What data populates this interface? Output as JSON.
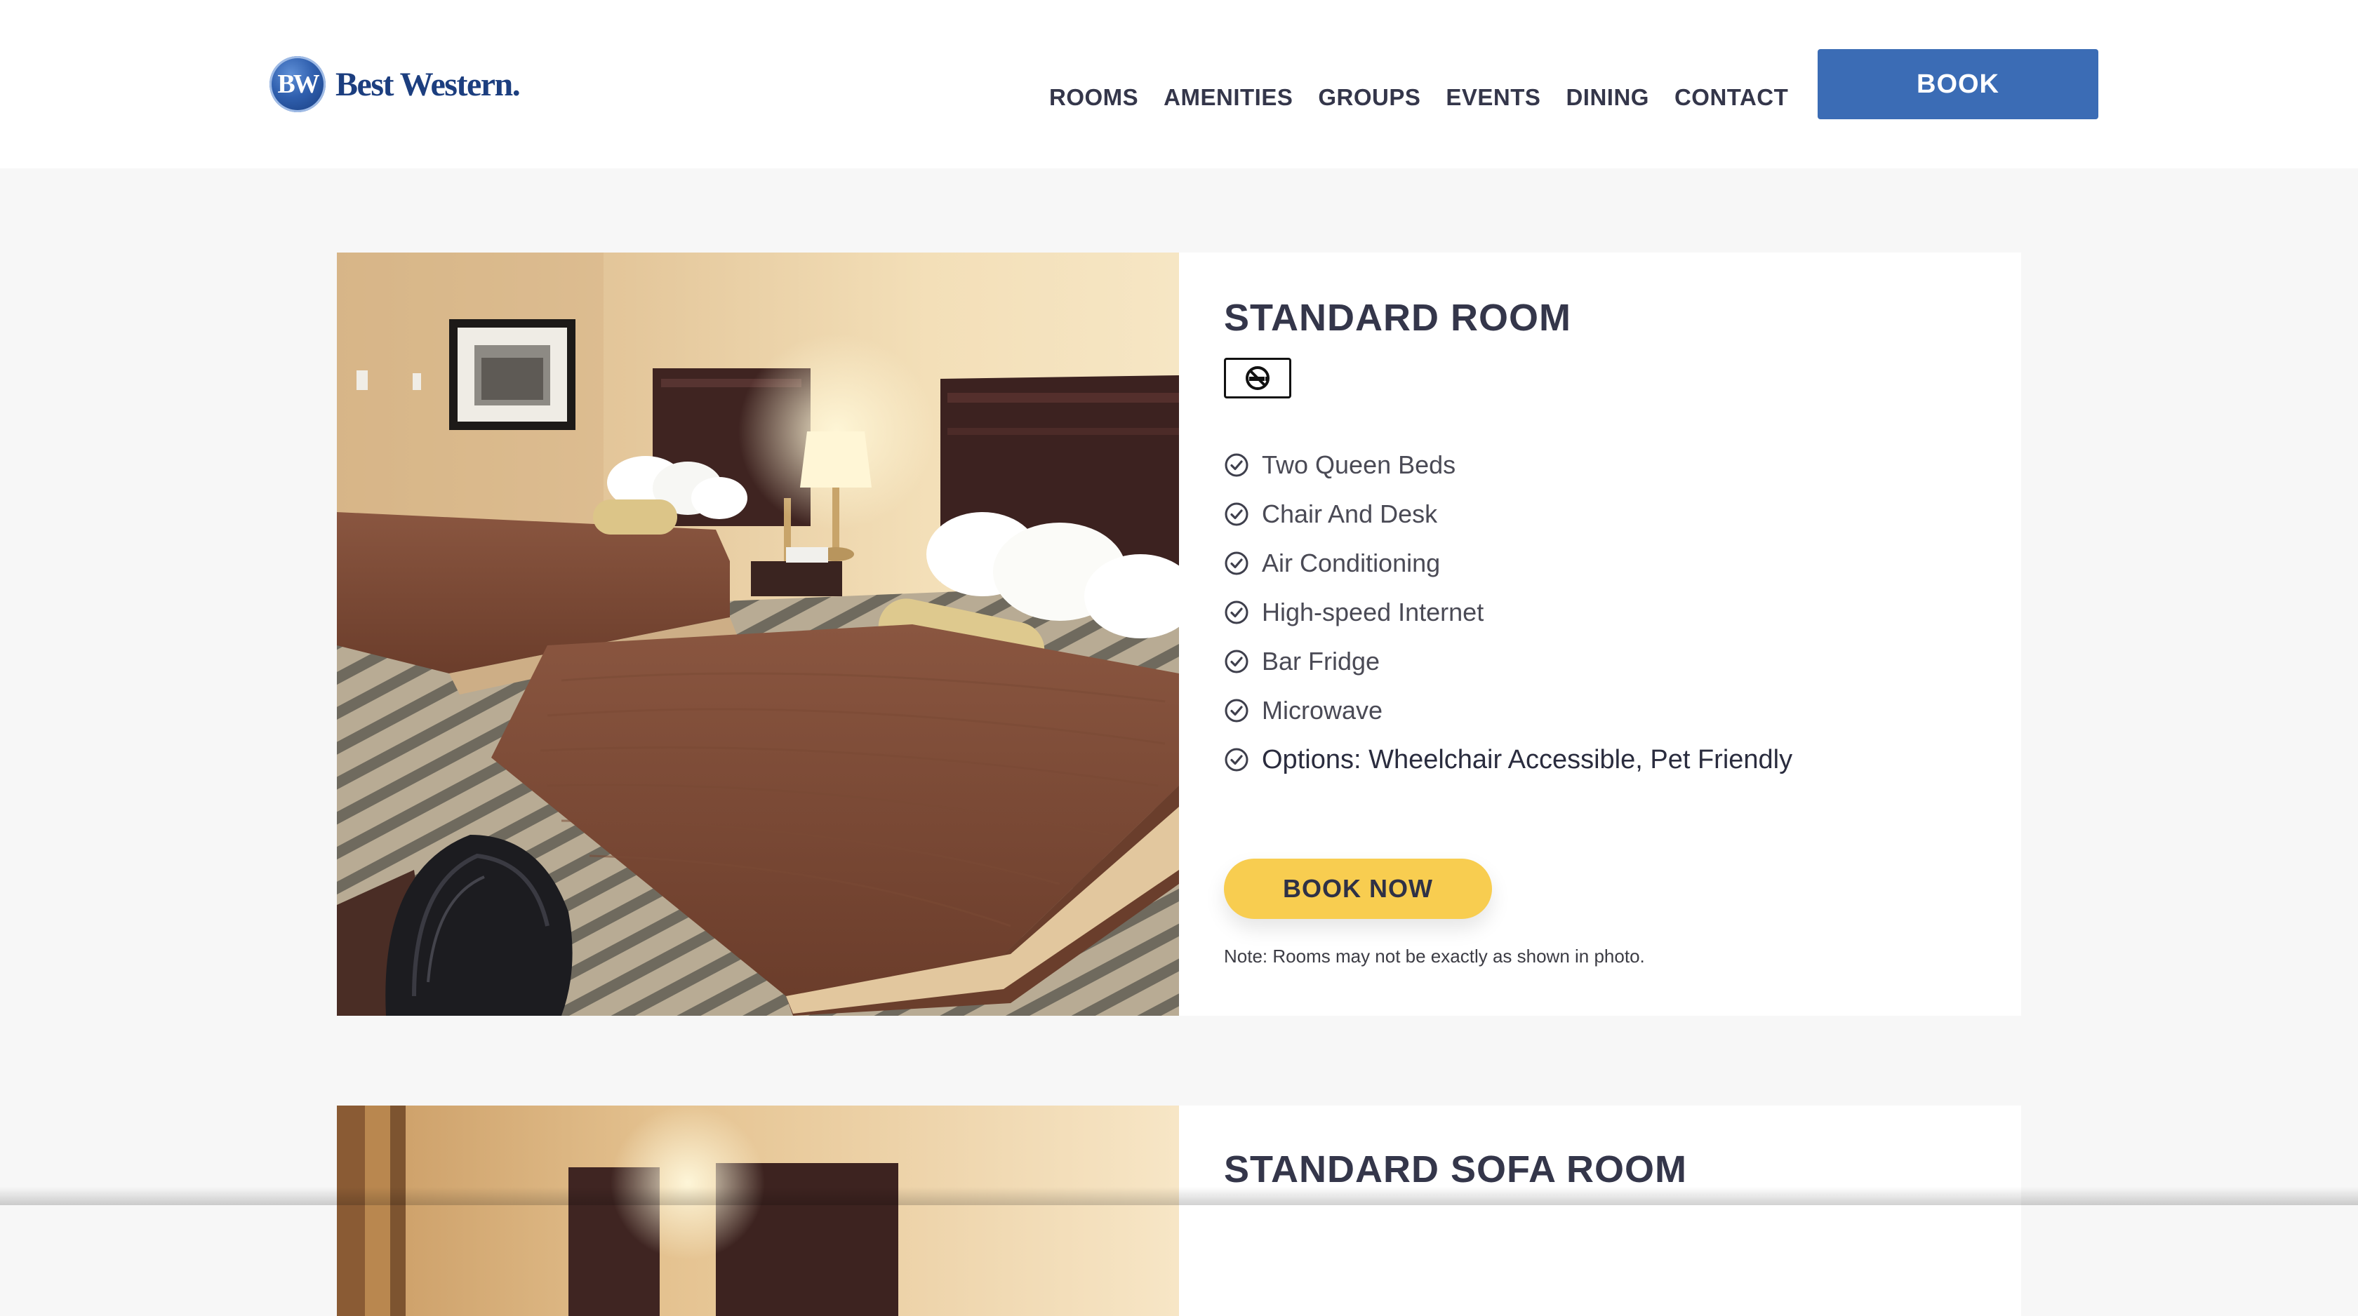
{
  "header": {
    "logo_mark": "BW",
    "logo_text": "Best Western.",
    "nav": [
      {
        "label": "ROOMS"
      },
      {
        "label": "AMENITIES"
      },
      {
        "label": "GROUPS"
      },
      {
        "label": "EVENTS"
      },
      {
        "label": "DINING"
      },
      {
        "label": "CONTACT"
      }
    ],
    "book_label": "BOOK",
    "book_color": "#3b6cb5"
  },
  "rooms": [
    {
      "title": "STANDARD ROOM",
      "badge_icon": "no-smoking-icon",
      "features": [
        "Two Queen Beds",
        "Chair And Desk",
        "Air Conditioning",
        "High-speed Internet",
        "Bar Fridge",
        "Microwave",
        "Options: Wheelchair Accessible, Pet Friendly"
      ],
      "feature_icon": "check-circle-icon",
      "book_now_label": "BOOK NOW",
      "book_now_color": "#f8cd50",
      "note": "Note: Rooms may not be exactly as shown in photo."
    },
    {
      "title": "STANDARD SOFA ROOM"
    }
  ]
}
